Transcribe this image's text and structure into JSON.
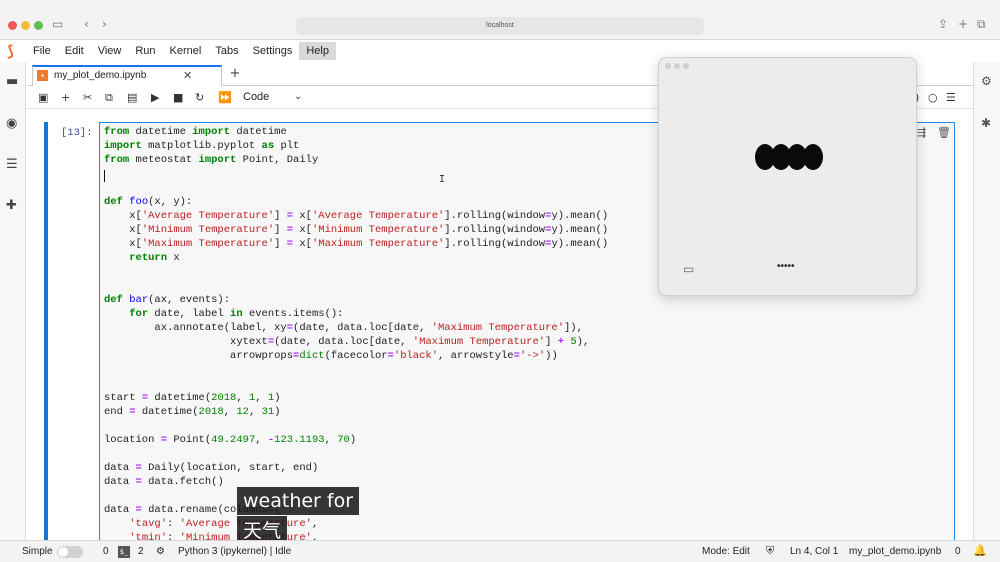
{
  "browser": {
    "address": "localhost",
    "icons": [
      "sidebar-toggle-icon",
      "back-arrow-icon",
      "forward-arrow-icon",
      "share-icon",
      "new-tab-icon",
      "tabs-overview-icon"
    ]
  },
  "menubar": {
    "items": [
      {
        "label": "File"
      },
      {
        "label": "Edit"
      },
      {
        "label": "View"
      },
      {
        "label": "Run"
      },
      {
        "label": "Kernel"
      },
      {
        "label": "Tabs"
      },
      {
        "label": "Settings"
      },
      {
        "label": "Help"
      }
    ],
    "active_index": 7
  },
  "tab": {
    "title": "my_plot_demo.ipynb",
    "close_glyph": "✕",
    "add_glyph": "+"
  },
  "toolbar": {
    "cell_type": "Code",
    "kernel_status_partial": ")"
  },
  "cell": {
    "prompt": "[13]:",
    "code_lines": [
      "from datetime import datetime",
      "import matplotlib.pyplot as plt",
      "from meteostat import Point, Daily",
      "",
      "",
      "def foo(x, y):",
      "    x['Average Temperature'] = x['Average Temperature'].rolling(window=y).mean()",
      "    x['Minimum Temperature'] = x['Minimum Temperature'].rolling(window=y).mean()",
      "    x['Maximum Temperature'] = x['Maximum Temperature'].rolling(window=y).mean()",
      "    return x",
      "",
      "",
      "def bar(ax, events):",
      "    for date, label in events.items():",
      "        ax.annotate(label, xy=(date, data.loc[date, 'Maximum Temperature']),",
      "                    xytext=(date, data.loc[date, 'Maximum Temperature'] + 5),",
      "                    arrowprops=dict(facecolor='black', arrowstyle='->'))",
      "",
      "",
      "start = datetime(2018, 1, 1)",
      "end = datetime(2018, 12, 31)",
      "",
      "location = Point(49.2497, -123.1193, 70)",
      "",
      "data = Daily(location, start, end)",
      "data = data.fetch()",
      "",
      "data = data.rename(columns={",
      "    'tavg': 'Average Temperature',",
      "    'tmin': 'Minimum Temperature',"
    ]
  },
  "popup": {
    "dots_label": "•••••"
  },
  "subtitles": {
    "line1": "weather for",
    "line2": "天气"
  },
  "statusbar": {
    "mode_label": "Simple",
    "count_a": "0",
    "count_b": "2",
    "kernel": "Python 3 (ipykernel) | Idle",
    "mode": "Mode: Edit",
    "position": "Ln 4, Col 1",
    "filename": "my_plot_demo.ipynb",
    "notifications": "0"
  },
  "colors": {
    "accent": "#1976d2",
    "jupyter_orange": "#e46e2e"
  }
}
